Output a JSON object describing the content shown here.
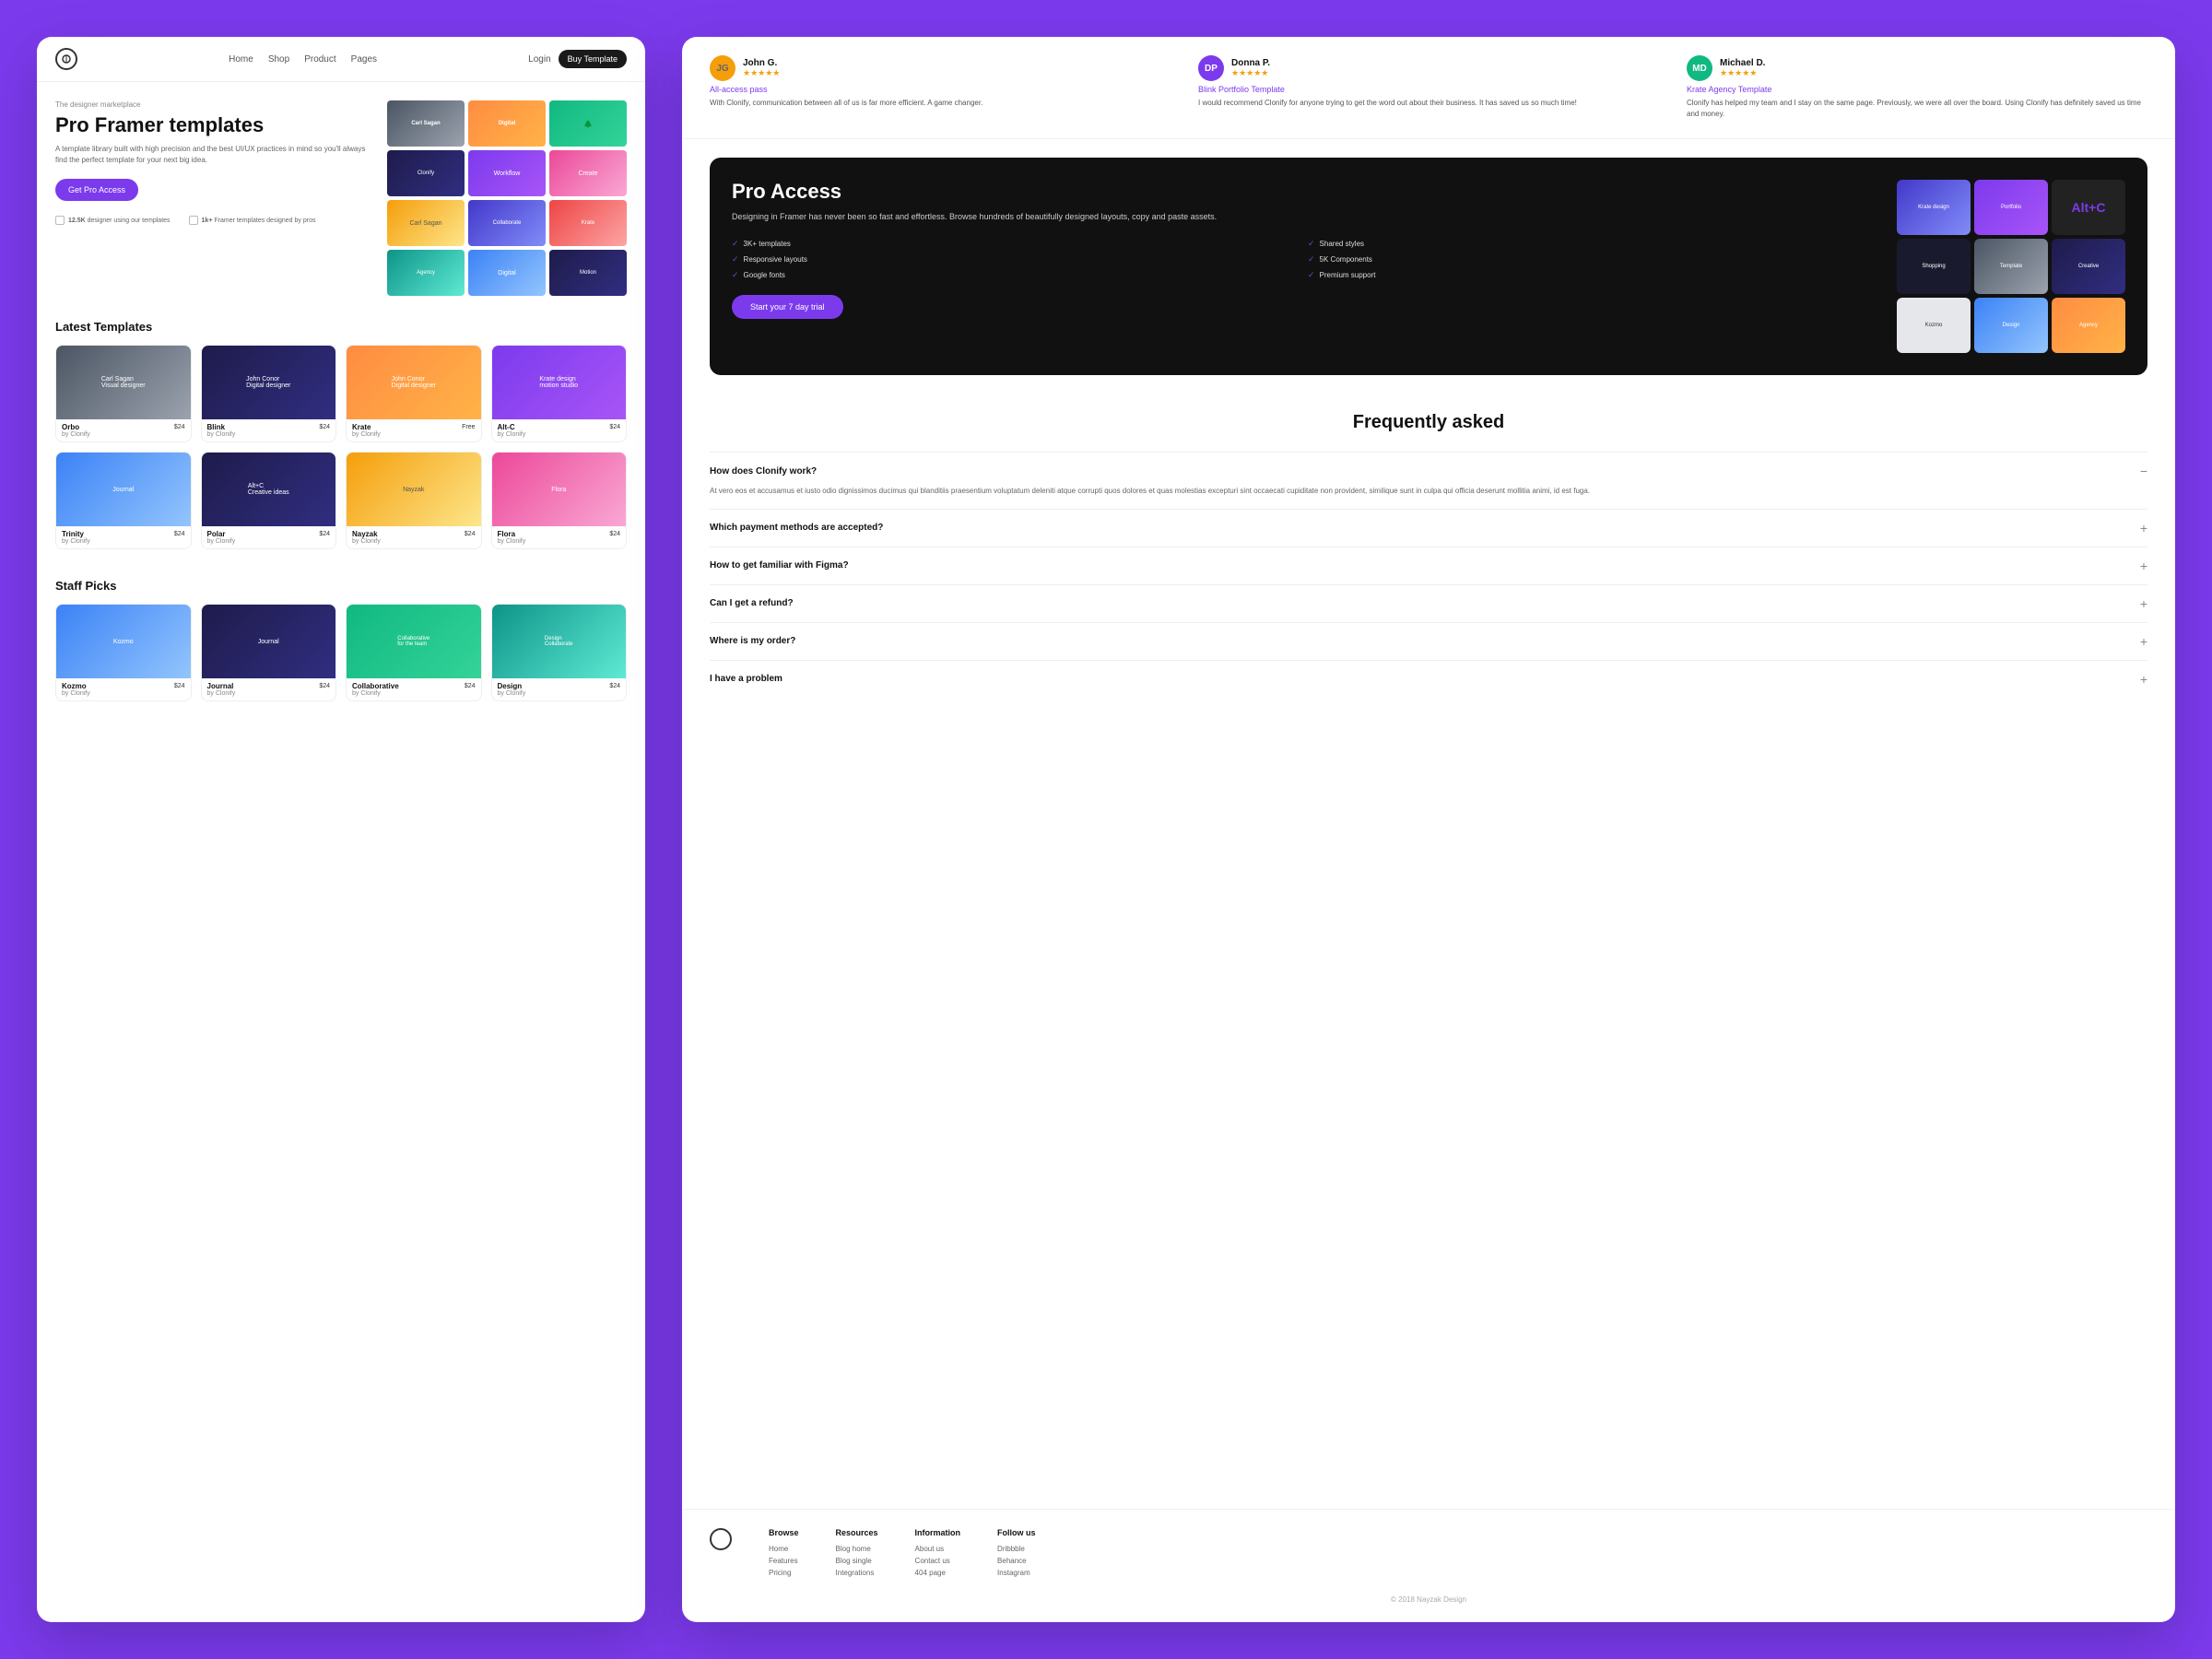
{
  "nav": {
    "links": [
      "Home",
      "Shop",
      "Product",
      "Pages"
    ],
    "login": "Login",
    "buy": "Buy Template"
  },
  "hero": {
    "subtitle": "The designer marketplace",
    "title": "Pro Framer templates",
    "desc": "A template library built with high precision and the best UI/UX practices in mind so you'll always find the perfect template for your next big idea.",
    "cta": "Get Pro Access",
    "stat1_number": "12.5K",
    "stat1_label": "designer using our templates",
    "stat2_number": "1k+",
    "stat2_label": "Framer templates designed by pros"
  },
  "sections": {
    "latest_title": "Latest Templates",
    "staff_title": "Staff Picks"
  },
  "latest_templates": [
    {
      "name": "Orbo",
      "author": "by Clonify",
      "price": "$24",
      "color": "t-gray"
    },
    {
      "name": "Blink",
      "author": "by Clonify",
      "price": "$24",
      "color": "t-dark"
    },
    {
      "name": "Krate",
      "author": "by Clonify",
      "price": "Free",
      "color": "t-orange"
    },
    {
      "name": "Alt-C",
      "author": "by Clonify",
      "price": "$24",
      "color": "t-purple"
    }
  ],
  "latest_templates_row2": [
    {
      "name": "Trinity",
      "author": "by Clonify",
      "price": "$24",
      "color": "t-blue"
    },
    {
      "name": "Polar",
      "author": "by Clonify",
      "price": "$24",
      "color": "t-dark"
    },
    {
      "name": "Nayzak",
      "author": "by Clonify",
      "price": "$24",
      "color": "t-yellow"
    },
    {
      "name": "Flora",
      "author": "by Clonify",
      "price": "$24",
      "color": "t-pink"
    }
  ],
  "staff_picks": [
    {
      "name": "Kozmo",
      "author": "by Clonify",
      "price": "$24",
      "color": "t-blue"
    },
    {
      "name": "Journal",
      "author": "by Clonify",
      "price": "$24",
      "color": "t-dark"
    },
    {
      "name": "Collaborative",
      "author": "by Clonify",
      "price": "$24",
      "color": "t-green"
    },
    {
      "name": "Design",
      "author": "by Clonify",
      "price": "$24",
      "color": "t-teal"
    }
  ],
  "reviews": [
    {
      "name": "John G.",
      "stars": "★★★★★",
      "template": "All-access pass",
      "text": "With Clonify, communication between all of us is far more efficient. A game changer.",
      "initials": "JG",
      "avatar_bg": "#f59e0b"
    },
    {
      "name": "Donna P.",
      "stars": "★★★★★",
      "template": "Blink Portfolio Template",
      "text": "I would recommend Clonify for anyone trying to get the word out about their business. It has saved us so much time!",
      "initials": "DP",
      "avatar_bg": "#7c3aed"
    },
    {
      "name": "Michael D.",
      "stars": "★★★★★",
      "template": "Krate Agency Template",
      "text": "Clonify has helped my team and I stay on the same page. Previously, we were all over the board. Using Clonify has definitely saved us time and money.",
      "initials": "MD",
      "avatar_bg": "#10b981"
    }
  ],
  "pro_access": {
    "title": "Pro Access",
    "desc": "Designing in Framer has never been so fast and effortless. Browse hundreds of beautifully designed layouts, copy and paste assets.",
    "features": [
      "3K+ templates",
      "Shared styles",
      "Responsive layouts",
      "5K Components",
      "Google fonts",
      "Premium support"
    ],
    "cta": "Start your 7 day trial"
  },
  "faq": {
    "title": "Frequently asked",
    "items": [
      {
        "question": "How does Clonify work?",
        "answer": "At vero eos et accusamus et iusto odio dignissimos ducimus qui blanditiis praesentium voluptatum deleniti atque corrupti quos dolores et quas molestias excepturi sint occaecati cupiditate non provident, similique sunt in culpa qui officia deserunt mollitia animi, id est fuga.",
        "open": true,
        "icon": "−"
      },
      {
        "question": "Which payment methods are accepted?",
        "answer": "",
        "open": false,
        "icon": "+"
      },
      {
        "question": "How to get familiar with Figma?",
        "answer": "",
        "open": false,
        "icon": "+"
      },
      {
        "question": "Can I get a refund?",
        "answer": "",
        "open": false,
        "icon": "+"
      },
      {
        "question": "Where is my order?",
        "answer": "",
        "open": false,
        "icon": "+"
      },
      {
        "question": "I have a problem",
        "answer": "",
        "open": false,
        "icon": "+"
      }
    ]
  },
  "footer": {
    "browse": {
      "title": "Browse",
      "links": [
        "Home",
        "Features",
        "Pricing"
      ]
    },
    "resources": {
      "title": "Resources",
      "links": [
        "Blog home",
        "Blog single",
        "Integrations"
      ]
    },
    "information": {
      "title": "Information",
      "links": [
        "About us",
        "Contact us",
        "404 page"
      ]
    },
    "follow": {
      "title": "Follow us",
      "links": [
        "Dribbble",
        "Behance",
        "Instagram"
      ]
    },
    "copyright": "© 2018 Nayzak Design"
  }
}
